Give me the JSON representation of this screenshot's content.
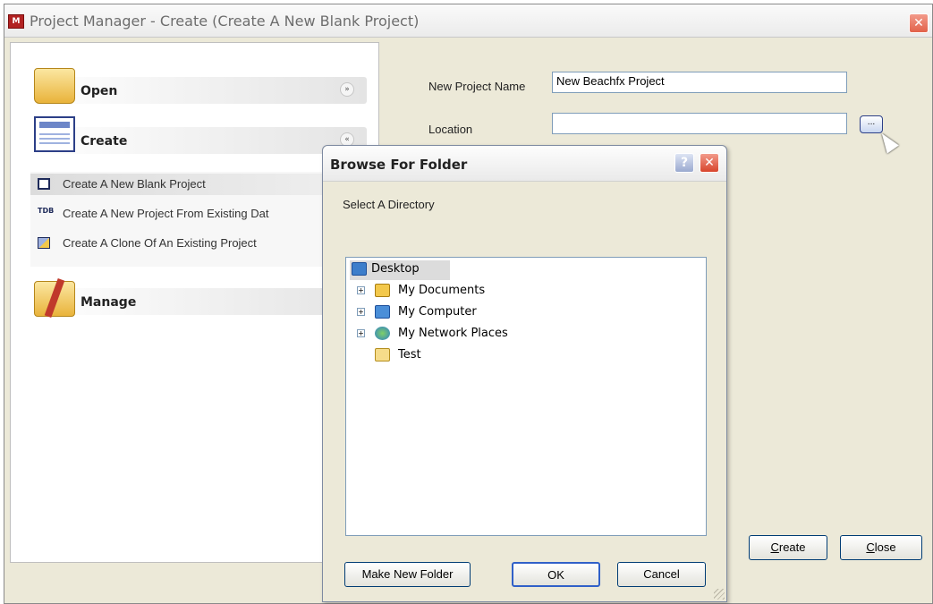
{
  "window": {
    "app_icon": "project-manager-icon",
    "app_icon_glyph": "M",
    "title": "Project Manager - Create (Create A New Blank Project)",
    "close_glyph": "✕"
  },
  "nav": {
    "open": {
      "label": "Open",
      "icon": "open-folder-icon",
      "chevron": "»"
    },
    "create": {
      "label": "Create",
      "icon": "create-form-icon",
      "chevron": "«"
    },
    "manage": {
      "label": "Manage",
      "icon": "manage-tools-icon"
    },
    "create_items": [
      {
        "label": "Create A New Blank Project",
        "icon": "blank-project-icon",
        "selected": true
      },
      {
        "label": "Create A New Project From Existing Dat",
        "icon": "tdb-project-icon",
        "icon_text": "TDB",
        "selected": false
      },
      {
        "label": "Create A Clone Of An Existing Project",
        "icon": "clone-project-icon",
        "selected": false
      }
    ]
  },
  "form": {
    "name_label": "New Project Name",
    "name_value": "New Beachfx Project",
    "location_label": "Location",
    "location_value": "",
    "browse_label": "...",
    "create_button": "reate",
    "create_mnemonic": "C",
    "close_button": "lose",
    "close_mnemonic": "C"
  },
  "dialog": {
    "title": "Browse For Folder",
    "help_glyph": "?",
    "close_glyph": "✕",
    "prompt": "Select A Directory",
    "tree": [
      {
        "label": "Desktop",
        "icon": "desktop-icon",
        "level": 0,
        "expandable": false,
        "selected": true
      },
      {
        "label": "My Documents",
        "icon": "my-documents-icon",
        "level": 1,
        "expandable": true,
        "expander": "+"
      },
      {
        "label": "My Computer",
        "icon": "my-computer-icon",
        "level": 1,
        "expandable": true,
        "expander": "+"
      },
      {
        "label": "My Network Places",
        "icon": "network-places-icon",
        "level": 1,
        "expandable": true,
        "expander": "+"
      },
      {
        "label": "Test",
        "icon": "folder-icon",
        "level": 1,
        "expandable": false
      }
    ],
    "make_new_folder": "Make New Folder",
    "ok": "OK",
    "cancel": "Cancel"
  },
  "colors": {
    "accent_blue": "#2c3f87",
    "window_bg": "#ece9d8",
    "close_red": "#e2624a"
  }
}
